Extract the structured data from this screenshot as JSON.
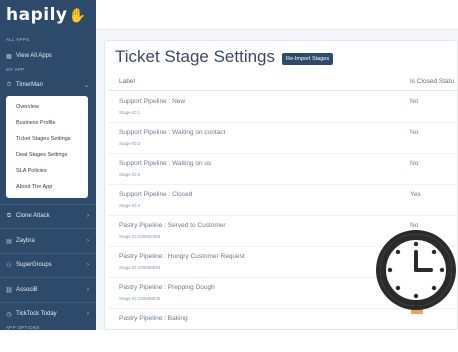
{
  "sidebar": {
    "logo": "hapily",
    "sections": {
      "all_apps": "ALL APPS",
      "my_app": "MY APP",
      "app_options": "APP OPTIONS"
    },
    "view_all": "View All Apps",
    "current_app": "TimerMan",
    "submenu": [
      "Overview",
      "Business Profile",
      "Ticket Stages Settings",
      "Deal Stages Settings",
      "SLA Policies",
      "About The App"
    ],
    "apps": [
      "Clone Attack",
      "Zaybra",
      "SuperGroups",
      "AssociB",
      "TickTock Today"
    ]
  },
  "page": {
    "title": "Ticket Stage Settings",
    "reimport_label": "Re-Import Stages"
  },
  "table": {
    "columns": [
      "Label",
      "Is Closed Statu"
    ],
    "rows": [
      {
        "name": "Support Pipeline : New",
        "id": "Stage ID:1",
        "closed": "No"
      },
      {
        "name": "Support Pipeline : Waiting on contact",
        "id": "Stage ID:2",
        "closed": "No"
      },
      {
        "name": "Support Pipeline : Waiting on us",
        "id": "Stage ID:3",
        "closed": "No"
      },
      {
        "name": "Support Pipeline : Closed",
        "id": "Stage ID:4",
        "closed": "Yes"
      },
      {
        "name": "Pastry Pipeline : Served to Customer",
        "id": "Stage ID:100562366",
        "closed": "No"
      },
      {
        "name": "Pastry Pipeline : Hungry Customer Request",
        "id": "Stage ID:100568834",
        "closed": ""
      },
      {
        "name": "Pastry Pipeline : Prepping Dough",
        "id": "Stage ID:100568835",
        "closed": ""
      },
      {
        "name": "Pastry Pipeline : Baking",
        "id": "",
        "closed": ""
      }
    ]
  },
  "colors": {
    "sidebar": "#2e4a6a",
    "accent": "#2e4a6a",
    "clock_face": "#ffffff",
    "clock_handle": "#e9a65f"
  },
  "icons": {
    "view_all": "grid-icon",
    "timerman": "timer-icon",
    "clone_attack": "clone-icon",
    "zaybra": "zebra-icon",
    "supergroups": "groups-icon",
    "associb": "link-icon",
    "ticktock": "clock-icon",
    "overlay": "clock-magnifier-icon"
  }
}
